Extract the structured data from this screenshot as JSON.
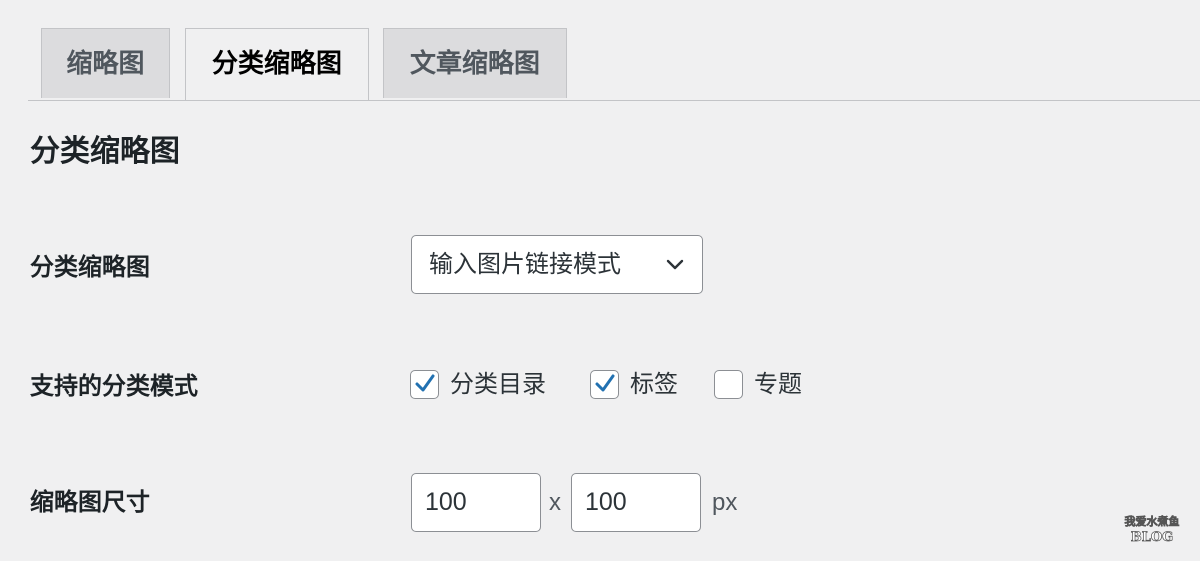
{
  "tabs": [
    {
      "label": "缩略图",
      "active": false
    },
    {
      "label": "分类缩略图",
      "active": true
    },
    {
      "label": "文章缩略图",
      "active": false
    }
  ],
  "section": {
    "title": "分类缩略图"
  },
  "fields": {
    "mode": {
      "label": "分类缩略图",
      "selected": "输入图片链接模式"
    },
    "taxonomies": {
      "label": "支持的分类模式",
      "options": [
        {
          "label": "分类目录",
          "checked": true
        },
        {
          "label": "标签",
          "checked": true
        },
        {
          "label": "专题",
          "checked": false
        }
      ]
    },
    "size": {
      "label": "缩略图尺寸",
      "width": "100",
      "height": "100",
      "separator": "x",
      "unit": "px"
    }
  },
  "colors": {
    "check": "#2271b1",
    "border": "#8c8f94",
    "background": "#f0f0f1"
  },
  "watermark": {
    "line1": "我爱水煮鱼",
    "line2": "BLOG"
  }
}
